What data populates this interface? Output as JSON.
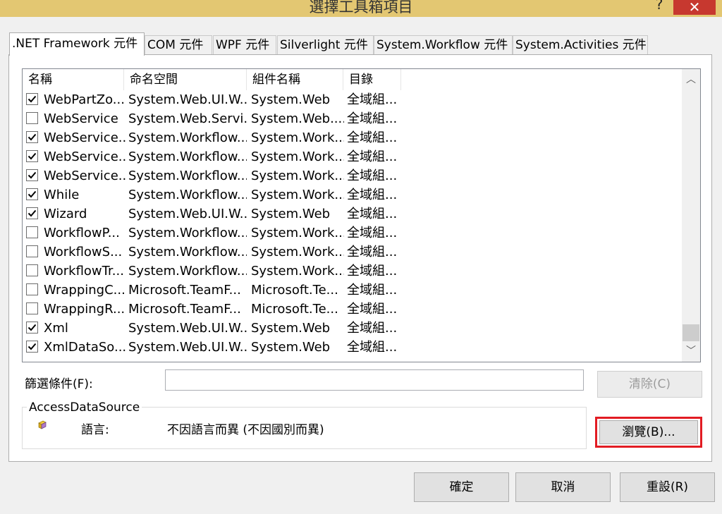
{
  "window": {
    "title": "選擇工具箱項目",
    "help": "?",
    "close": "✕"
  },
  "tabs": [
    {
      "label": ".NET Framework 元件"
    },
    {
      "label": "COM 元件"
    },
    {
      "label": "WPF 元件"
    },
    {
      "label": "Silverlight 元件"
    },
    {
      "label": "System.Workflow 元件"
    },
    {
      "label": "System.Activities 元件"
    }
  ],
  "list": {
    "columns": [
      "名稱",
      "命名空間",
      "組件名稱",
      "目錄"
    ],
    "rows": [
      {
        "checked": true,
        "name": "WebPartZo...",
        "namespace": "System.Web.UI.W...",
        "assembly": "System.Web",
        "dir": "全域組..."
      },
      {
        "checked": false,
        "name": "WebService",
        "namespace": "System.Web.Servi...",
        "assembly": "System.Web....",
        "dir": "全域組..."
      },
      {
        "checked": true,
        "name": "WebService...",
        "namespace": "System.Workflow....",
        "assembly": "System.Work...",
        "dir": "全域組..."
      },
      {
        "checked": true,
        "name": "WebService...",
        "namespace": "System.Workflow....",
        "assembly": "System.Work...",
        "dir": "全域組..."
      },
      {
        "checked": true,
        "name": "WebService...",
        "namespace": "System.Workflow....",
        "assembly": "System.Work...",
        "dir": "全域組..."
      },
      {
        "checked": true,
        "name": "While",
        "namespace": "System.Workflow....",
        "assembly": "System.Work...",
        "dir": "全域組..."
      },
      {
        "checked": true,
        "name": "Wizard",
        "namespace": "System.Web.UI.W...",
        "assembly": "System.Web",
        "dir": "全域組..."
      },
      {
        "checked": false,
        "name": "WorkflowP...",
        "namespace": "System.Workflow....",
        "assembly": "System.Work...",
        "dir": "全域組..."
      },
      {
        "checked": false,
        "name": "WorkflowS...",
        "namespace": "System.Workflow....",
        "assembly": "System.Work...",
        "dir": "全域組..."
      },
      {
        "checked": false,
        "name": "WorkflowTr...",
        "namespace": "System.Workflow....",
        "assembly": "System.Work...",
        "dir": "全域組..."
      },
      {
        "checked": false,
        "name": "WrappingC...",
        "namespace": "Microsoft.TeamF...",
        "assembly": "Microsoft.Te...",
        "dir": "全域組..."
      },
      {
        "checked": false,
        "name": "WrappingR...",
        "namespace": "Microsoft.TeamF...",
        "assembly": "Microsoft.Te...",
        "dir": "全域組..."
      },
      {
        "checked": true,
        "name": "Xml",
        "namespace": "System.Web.UI.W...",
        "assembly": "System.Web",
        "dir": "全域組..."
      },
      {
        "checked": true,
        "name": "XmlDataSo...",
        "namespace": "System.Web.UI.W...",
        "assembly": "System.Web",
        "dir": "全域組..."
      }
    ]
  },
  "scrollbar": {
    "up": "︿",
    "down": "﹀"
  },
  "filter": {
    "label": "篩選條件(F):",
    "value": "",
    "clear_label": "清除(C)"
  },
  "info": {
    "group_title": "AccessDataSource",
    "icon": "component-icon",
    "language_key": "語言:",
    "language_value": "不因語言而異 (不因國別而異)"
  },
  "buttons": {
    "browse": "瀏覽(B)...",
    "ok": "確定",
    "cancel": "取消",
    "reset": "重設(R)"
  },
  "colors": {
    "titlebar": "#e3c772",
    "close": "#c7382f",
    "highlight": "#e21c23"
  }
}
